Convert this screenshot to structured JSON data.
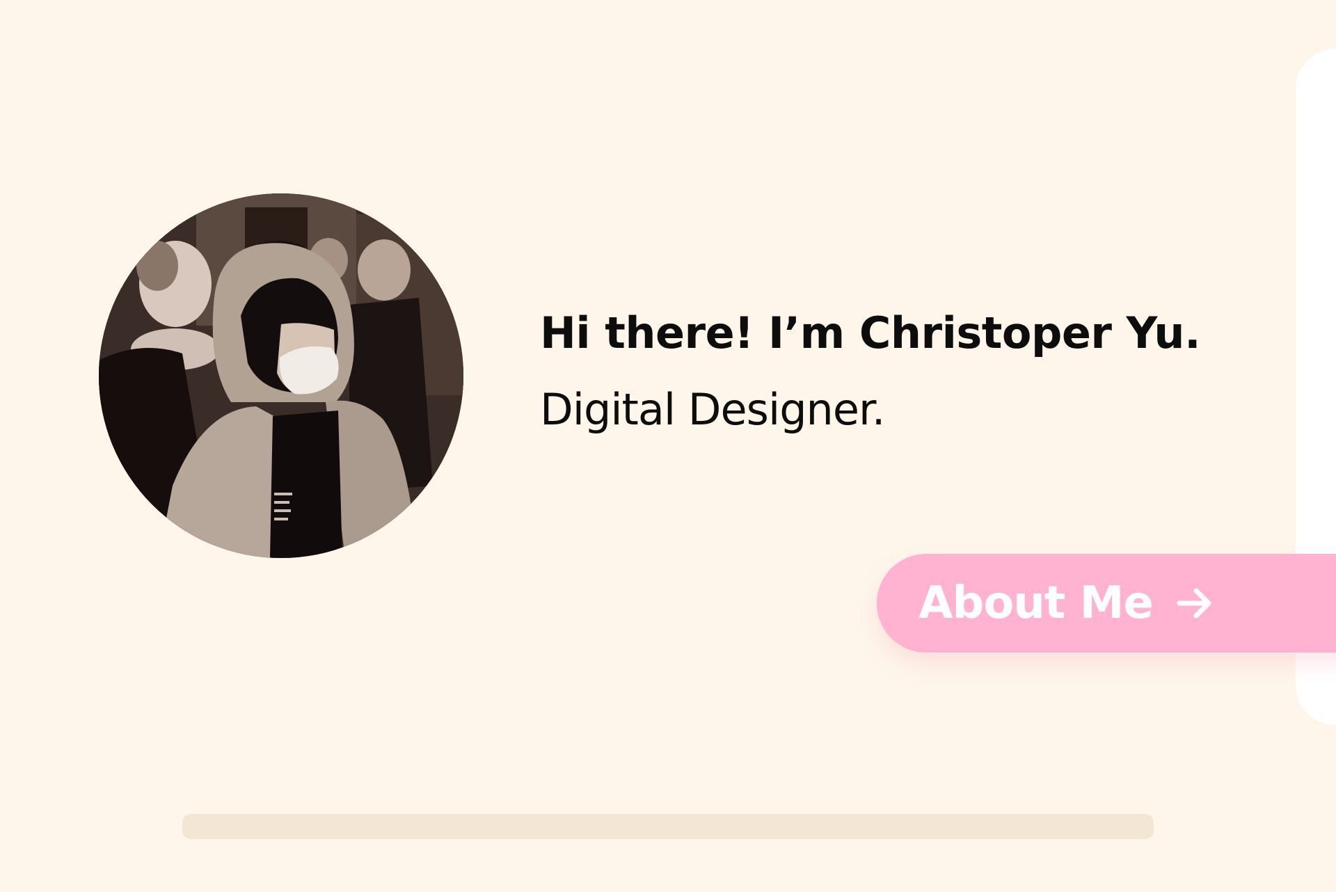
{
  "hero": {
    "greeting": "Hi there! I’m Christoper Yu.",
    "role": "Digital Designer.",
    "avatar_icon": "profile-photo",
    "about_button": {
      "label": "About Me",
      "icon": "arrow-right-icon"
    }
  },
  "colors": {
    "background": "#fef6eb",
    "panel": "#ffffff",
    "text": "#0d0d0d",
    "button": "#ffb3d1",
    "button_text": "#ffffff",
    "scroll_track": "#f4e6d4"
  }
}
